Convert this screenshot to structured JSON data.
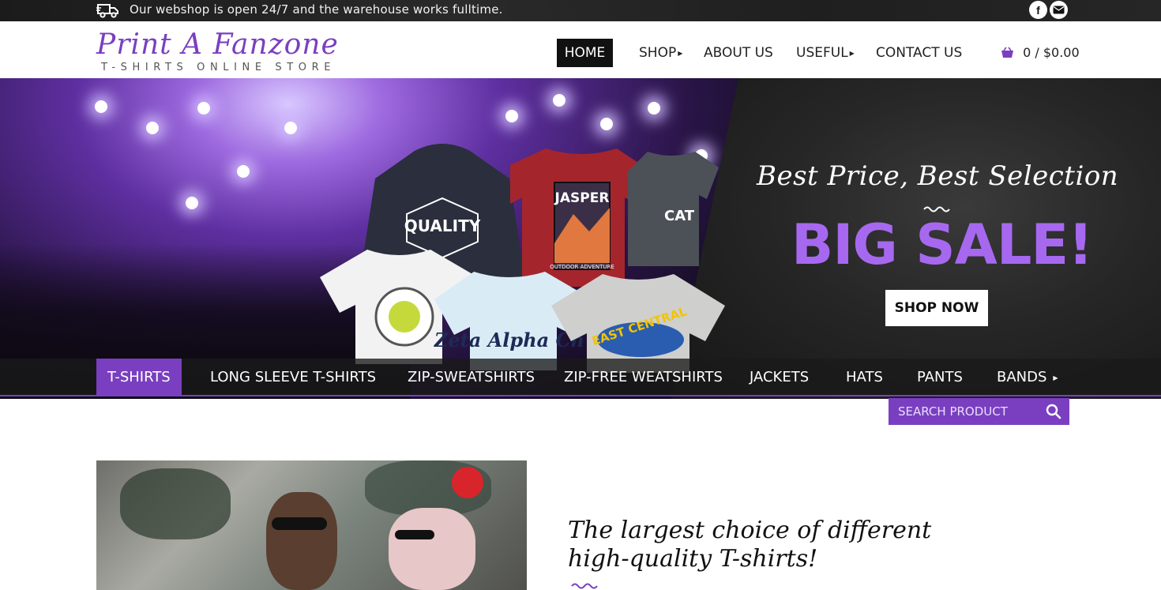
{
  "topbar": {
    "notice": "Our webshop is open 24/7 and the warehouse works fulltime.",
    "icons": [
      "truck-icon",
      "facebook-icon",
      "mail-icon"
    ]
  },
  "header": {
    "logo_main": "Print A Fanzone",
    "logo_sub": "T-SHIRTS ONLINE STORE",
    "nav": [
      {
        "label": "HOME",
        "active": true
      },
      {
        "label": "SHOP",
        "has_submenu": true
      },
      {
        "label": "ABOUT US"
      },
      {
        "label": "USEFUL",
        "has_submenu": true
      },
      {
        "label": "CONTACT US"
      }
    ],
    "cart": "0 / $0.00"
  },
  "hero": {
    "tagline": "Best Price, Best Selection",
    "headline": "BIG SALE!",
    "cta": "SHOP NOW",
    "shirts": {
      "quality": "QUALITY",
      "jasper": "JASPER",
      "outdoor": "OUTDOOR ADVENTURE",
      "zeta": "Zeta Alpha Ch",
      "east_central": "EAST CENTRAL",
      "cat": "CAT"
    }
  },
  "categories": [
    {
      "label": "T-SHIRTS",
      "active": true
    },
    {
      "label": "LONG SLEEVE T-SHIRTS"
    },
    {
      "label": "ZIP-SWEATSHIRTS"
    },
    {
      "label": "ZIP-FREE WEATSHIRTS"
    },
    {
      "label": "JACKETS"
    },
    {
      "label": "HATS"
    },
    {
      "label": "PANTS"
    },
    {
      "label": "BANDS",
      "has_submenu": true
    }
  ],
  "search": {
    "placeholder": "SEARCH PRODUCT"
  },
  "section": {
    "title_line1": "The largest choice of different",
    "title_line2": "high-quality T-shirts!"
  },
  "colors": {
    "accent": "#7a3fc0",
    "sale": "#a768f0",
    "dark": "#111111"
  }
}
